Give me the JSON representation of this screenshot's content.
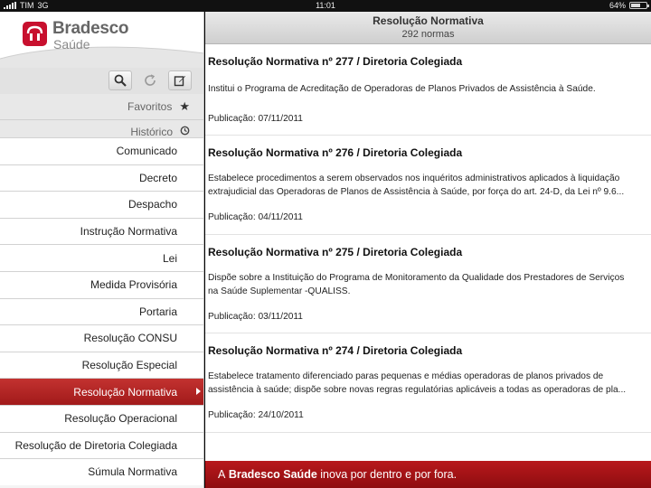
{
  "status_bar": {
    "carrier": "TIM",
    "network": "3G",
    "time": "11:01",
    "battery": "64%",
    "battery_level": 0.64
  },
  "brand": {
    "name": "Bradesco",
    "sub": "Saúde",
    "color": "#c8102e"
  },
  "toolbar": {
    "icons": [
      "search-icon",
      "refresh-icon",
      "edit-icon"
    ]
  },
  "nav": {
    "favorites": "Favoritos",
    "history": "Histórico"
  },
  "categories": [
    "Comunicado",
    "Decreto",
    "Despacho",
    "Instrução Normativa",
    "Lei",
    "Medida Provisória",
    "Portaria",
    "Resolução CONSU",
    "Resolução Especial",
    "Resolução Normativa",
    "Resolução Operacional",
    "Resolução de Diretoria Colegiada",
    "Súmula Normativa"
  ],
  "selected_category": "Resolução Normativa",
  "main": {
    "title": "Resolução Normativa",
    "count": "292 normas",
    "items": [
      {
        "title": "Resolução Normativa nº 277 / Diretoria Colegiada",
        "desc": [
          "Institui o Programa de Acreditação de Operadoras de Planos Privados de Assistência à Saúde."
        ],
        "pub": "Publicação: 07/11/2011"
      },
      {
        "title": "Resolução Normativa nº 276 / Diretoria Colegiada",
        "desc": [
          "Estabelece procedimentos a serem observados nos inquéritos administrativos aplicados à liquidação",
          "extrajudicial das Operadoras de Planos de Assistência à Saúde, por força do art. 24-D, da Lei nº 9.6..."
        ],
        "pub": "Publicação: 04/11/2011"
      },
      {
        "title": "Resolução Normativa nº 275 / Diretoria Colegiada",
        "desc": [
          "Dispõe sobre a Instituição do Programa de Monitoramento da Qualidade dos Prestadores de Serviços",
          "na Saúde Suplementar -QUALISS."
        ],
        "pub": "Publicação: 03/11/2011"
      },
      {
        "title": "Resolução Normativa nº 274 / Diretoria Colegiada",
        "desc": [
          "Estabelece tratamento diferenciado paras pequenas e médias operadoras de planos privados de",
          "assistência à saúde; dispõe sobre novas regras regulatórias aplicáveis a todas as operadoras de pla..."
        ],
        "pub": "Publicação: 24/10/2011"
      }
    ]
  },
  "footer": {
    "prefix": "A",
    "brand": "Bradesco Saúde",
    "suffix": "inova por dentro e por fora."
  }
}
